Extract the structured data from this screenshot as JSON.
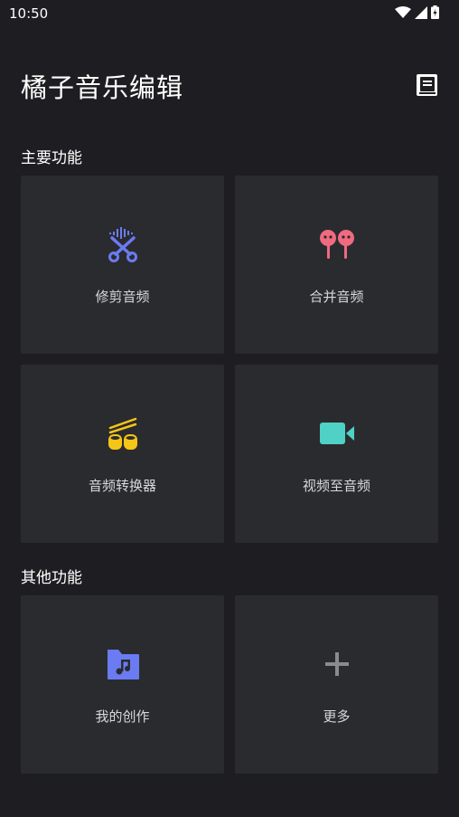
{
  "status_bar": {
    "time": "10:50"
  },
  "header": {
    "title": "橘子音乐编辑"
  },
  "sections": {
    "main": {
      "title": "主要功能",
      "cards": [
        {
          "label": "修剪音频",
          "icon": "scissors-audio-icon"
        },
        {
          "label": "合并音频",
          "icon": "earbuds-icon"
        },
        {
          "label": "音频转换器",
          "icon": "converter-icon"
        },
        {
          "label": "视频至音频",
          "icon": "video-camera-icon"
        }
      ]
    },
    "other": {
      "title": "其他功能",
      "cards": [
        {
          "label": "我的创作",
          "icon": "music-folder-icon"
        },
        {
          "label": "更多",
          "icon": "plus-icon"
        }
      ]
    }
  },
  "colors": {
    "background": "#1e1e22",
    "card": "#2a2b2f",
    "trim_blue": "#6b7bf2",
    "merge_pink": "#f06a80",
    "convert_yellow": "#f5c518",
    "video_teal": "#4fd1c5",
    "folder_blue": "#6b7bf2",
    "plus_gray": "#8a8a8f"
  }
}
